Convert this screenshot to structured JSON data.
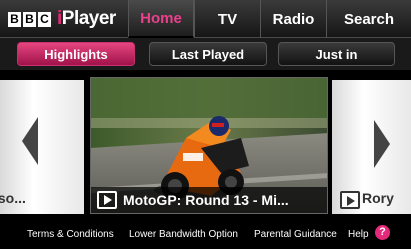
{
  "brand": {
    "bbc_letters": [
      "B",
      "B",
      "C"
    ],
    "iplayer_text": "iPlayer",
    "accent_color": "#e5297a"
  },
  "nav": {
    "tabs": [
      {
        "label": "Home",
        "selected": true
      },
      {
        "label": "TV",
        "selected": false
      },
      {
        "label": "Radio",
        "selected": false
      },
      {
        "label": "Search",
        "selected": false
      }
    ]
  },
  "subnav": {
    "buttons": [
      {
        "label": "Highlights",
        "selected": true
      },
      {
        "label": "Last Played",
        "selected": false
      },
      {
        "label": "Just in",
        "selected": false
      }
    ]
  },
  "carousel": {
    "left_label": "iso...",
    "featured_title": "MotoGP: Round 13 - Mi...",
    "right_label": "Rory"
  },
  "footer": {
    "terms": "Terms & Conditions",
    "bandwidth": "Lower Bandwidth Option",
    "guidance": "Parental Guidance",
    "help": "Help",
    "help_icon": "?"
  }
}
